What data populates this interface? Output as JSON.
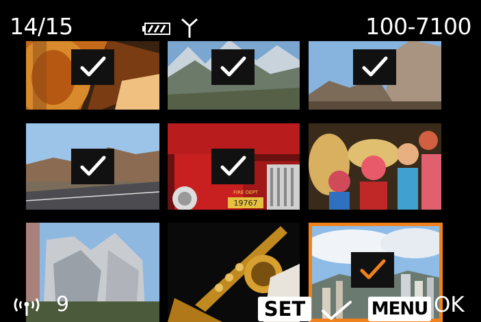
{
  "header": {
    "image_counter": "14/15",
    "folder_file": "100-7100",
    "battery_icon": "battery-full-icon",
    "antenna_icon": "antenna-icon"
  },
  "grid": {
    "thumbnails": [
      {
        "subject": "wooden-guitar",
        "checked": true,
        "selected": false
      },
      {
        "subject": "mountain-valley",
        "checked": true,
        "selected": false
      },
      {
        "subject": "desert-rocks",
        "checked": true,
        "selected": false
      },
      {
        "subject": "desert-road",
        "checked": true,
        "selected": false
      },
      {
        "subject": "fire-truck",
        "checked": true,
        "selected": false
      },
      {
        "subject": "puppets",
        "checked": false,
        "selected": false
      },
      {
        "subject": "modern-building",
        "checked": false,
        "selected": false
      },
      {
        "subject": "saxophone",
        "checked": false,
        "selected": false
      },
      {
        "subject": "city-skyline",
        "checked": true,
        "selected": true
      }
    ],
    "plate_text": "19767",
    "truck_sign": "FIRE DEPT"
  },
  "footer": {
    "wifi_icon": "wifi-icon",
    "selected_count": "9",
    "set_label": "SET",
    "menu_label": "MENU",
    "ok_label": "OK"
  },
  "colors": {
    "selection": "#f0821e",
    "check": "#ffffff",
    "check_selected": "#f0821e"
  }
}
